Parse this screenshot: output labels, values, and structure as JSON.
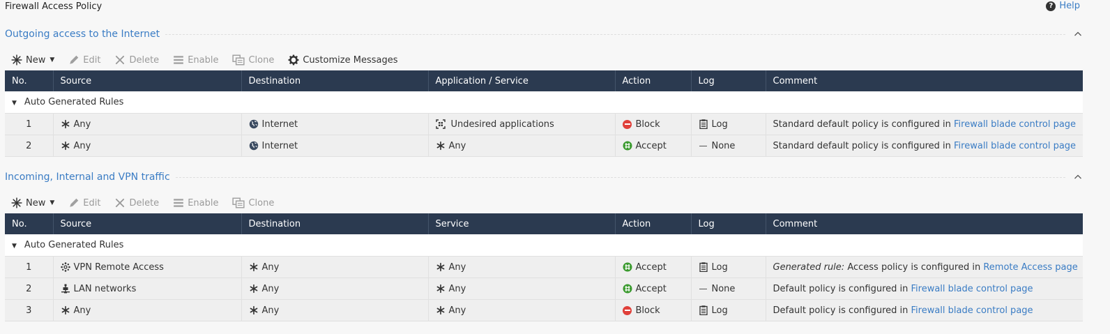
{
  "page": {
    "title": "Firewall Access Policy",
    "help_label": "Help"
  },
  "sections": [
    {
      "title": "Outgoing access to the Internet",
      "toolbar": {
        "new": "New",
        "edit": "Edit",
        "delete": "Delete",
        "enable": "Enable",
        "clone": "Clone",
        "customize": "Customize Messages"
      },
      "columns": [
        "No.",
        "Source",
        "Destination",
        "Application / Service",
        "Action",
        "Log",
        "Comment"
      ],
      "group_label": "Auto Generated Rules",
      "rows": [
        {
          "no": "1",
          "source": "Any",
          "source_icon": "asterisk-icon",
          "destination": "Internet",
          "destination_icon": "globe-icon",
          "service": "Undesired applications",
          "service_icon": "applications-icon",
          "action": "Block",
          "log": "Log",
          "comment_text": "Standard default policy is configured in ",
          "comment_link": "Firewall blade control page"
        },
        {
          "no": "2",
          "source": "Any",
          "source_icon": "asterisk-icon",
          "destination": "Internet",
          "destination_icon": "globe-icon",
          "service": "Any",
          "service_icon": "asterisk-icon",
          "action": "Accept",
          "log": "None",
          "comment_text": "Standard default policy is configured in ",
          "comment_link": "Firewall blade control page"
        }
      ]
    },
    {
      "title": "Incoming, Internal and VPN traffic",
      "toolbar": {
        "new": "New",
        "edit": "Edit",
        "delete": "Delete",
        "enable": "Enable",
        "clone": "Clone"
      },
      "columns": [
        "No.",
        "Source",
        "Destination",
        "Service",
        "Action",
        "Log",
        "Comment"
      ],
      "group_label": "Auto Generated Rules",
      "rows": [
        {
          "no": "1",
          "source": "VPN Remote Access",
          "source_icon": "vpn-icon",
          "destination": "Any",
          "service": "Any",
          "action": "Accept",
          "log": "Log",
          "comment_prefix": "Generated rule:",
          "comment_text": " Access policy is configured in ",
          "comment_link": "Remote Access page"
        },
        {
          "no": "2",
          "source": "LAN networks",
          "source_icon": "network-icon",
          "destination": "Any",
          "service": "Any",
          "action": "Accept",
          "log": "None",
          "comment_text": "Default policy is configured in ",
          "comment_link": "Firewall blade control page"
        },
        {
          "no": "3",
          "source": "Any",
          "source_icon": "asterisk-icon",
          "destination": "Any",
          "service": "Any",
          "action": "Block",
          "log": "Log",
          "comment_text": "Default policy is configured in ",
          "comment_link": "Firewall blade control page"
        }
      ]
    }
  ],
  "colors": {
    "header_bg": "#2b3a50",
    "link": "#3a7cc4",
    "block": "#e0403a",
    "accept": "#3a9a2e"
  }
}
